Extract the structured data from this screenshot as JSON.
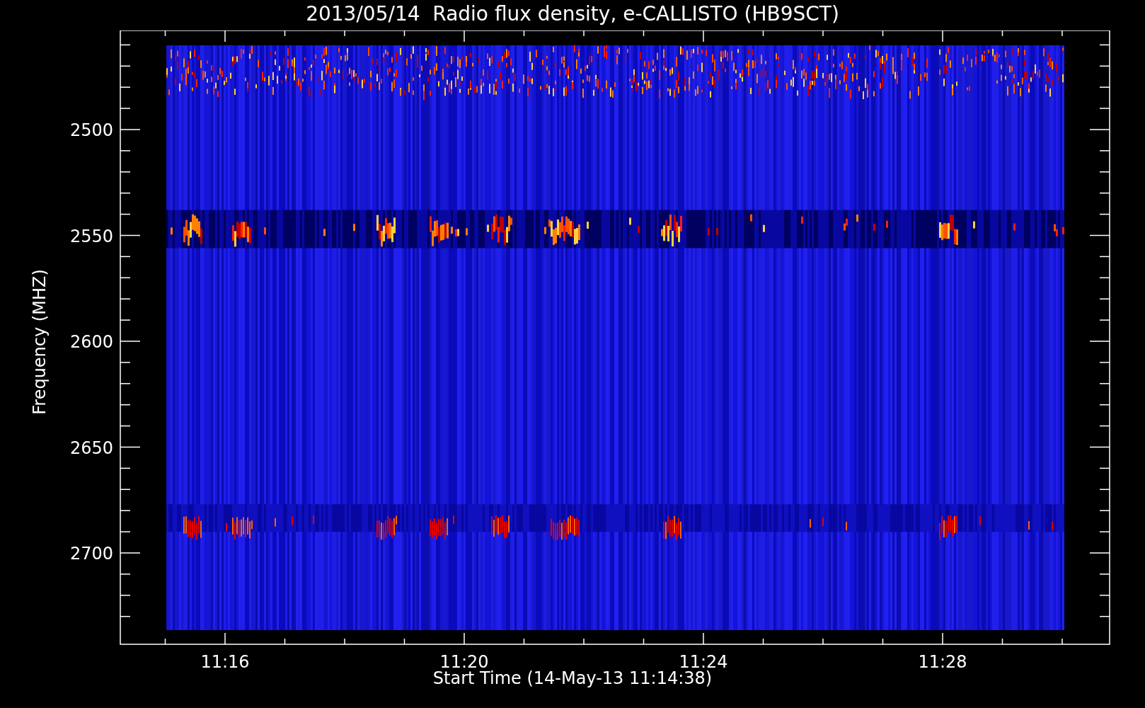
{
  "title": "2013/05/14  Radio flux density, e-CALLISTO (HB9SCT)",
  "ylabel": "Frequency (MHZ)",
  "xlabel": "Start Time (14-May-13 11:14:38)",
  "yticks": [
    "2500",
    "2550",
    "2600",
    "2650",
    "2700"
  ],
  "xticks": [
    "11:16",
    "11:20",
    "11:24",
    "11:28"
  ]
}
